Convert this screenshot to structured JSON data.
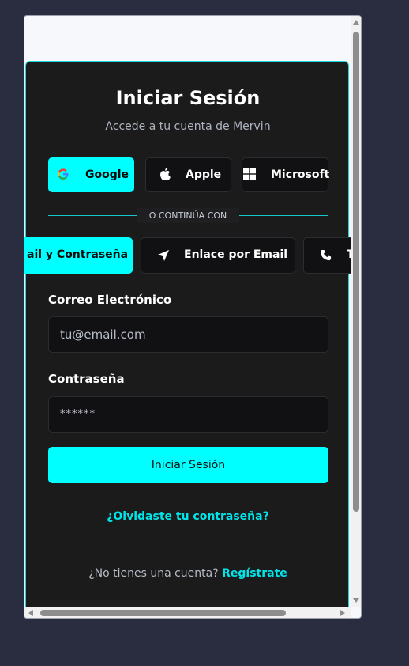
{
  "card": {
    "title": "Iniciar Sesión",
    "subtitle": "Accede a tu cuenta de Mervin"
  },
  "social": [
    {
      "label": "Google",
      "icon": "google-icon"
    },
    {
      "label": "Apple",
      "icon": "apple-icon"
    },
    {
      "label": "Microsoft",
      "icon": "microsoft-icon"
    }
  ],
  "divider": "O CONTINÚA CON",
  "tabs": [
    {
      "label": "ail y Contraseña",
      "active": true
    },
    {
      "label": "Enlace por Email",
      "icon": "send-icon"
    },
    {
      "label": "T",
      "icon": "phone-icon"
    }
  ],
  "form": {
    "email_label": "Correo Electrónico",
    "email_placeholder": "tu@email.com",
    "password_label": "Contraseña",
    "password_value": "******",
    "submit_label": "Iniciar Sesión"
  },
  "links": {
    "forgot": "¿Olvidaste tu contraseña?",
    "no_account": "¿No tienes una cuenta? ",
    "register": "Regístrate"
  },
  "colors": {
    "accent": "#00ffff",
    "card_bg": "#1b1b1c",
    "page_bg": "#2a2d3f"
  }
}
